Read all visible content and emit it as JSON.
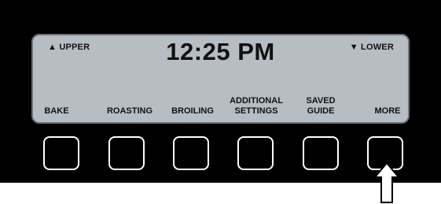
{
  "display": {
    "upper_label": "▲ UPPER",
    "time": "12:25 PM",
    "lower_label": "▼ LOWER"
  },
  "soft_keys": [
    {
      "label": "BAKE"
    },
    {
      "label": "ROASTING"
    },
    {
      "label": "BROILING"
    },
    {
      "label": "ADDITIONAL\nSETTINGS"
    },
    {
      "label": "SAVED\nGUIDE"
    },
    {
      "label": "MORE"
    }
  ],
  "colors": {
    "panel": "#000000",
    "lcd_background": "#b7bec3",
    "lcd_text": "#111111",
    "key_border": "#ffffff"
  },
  "indicator": {
    "icon": "up-arrow-icon",
    "points_to": "MORE"
  }
}
